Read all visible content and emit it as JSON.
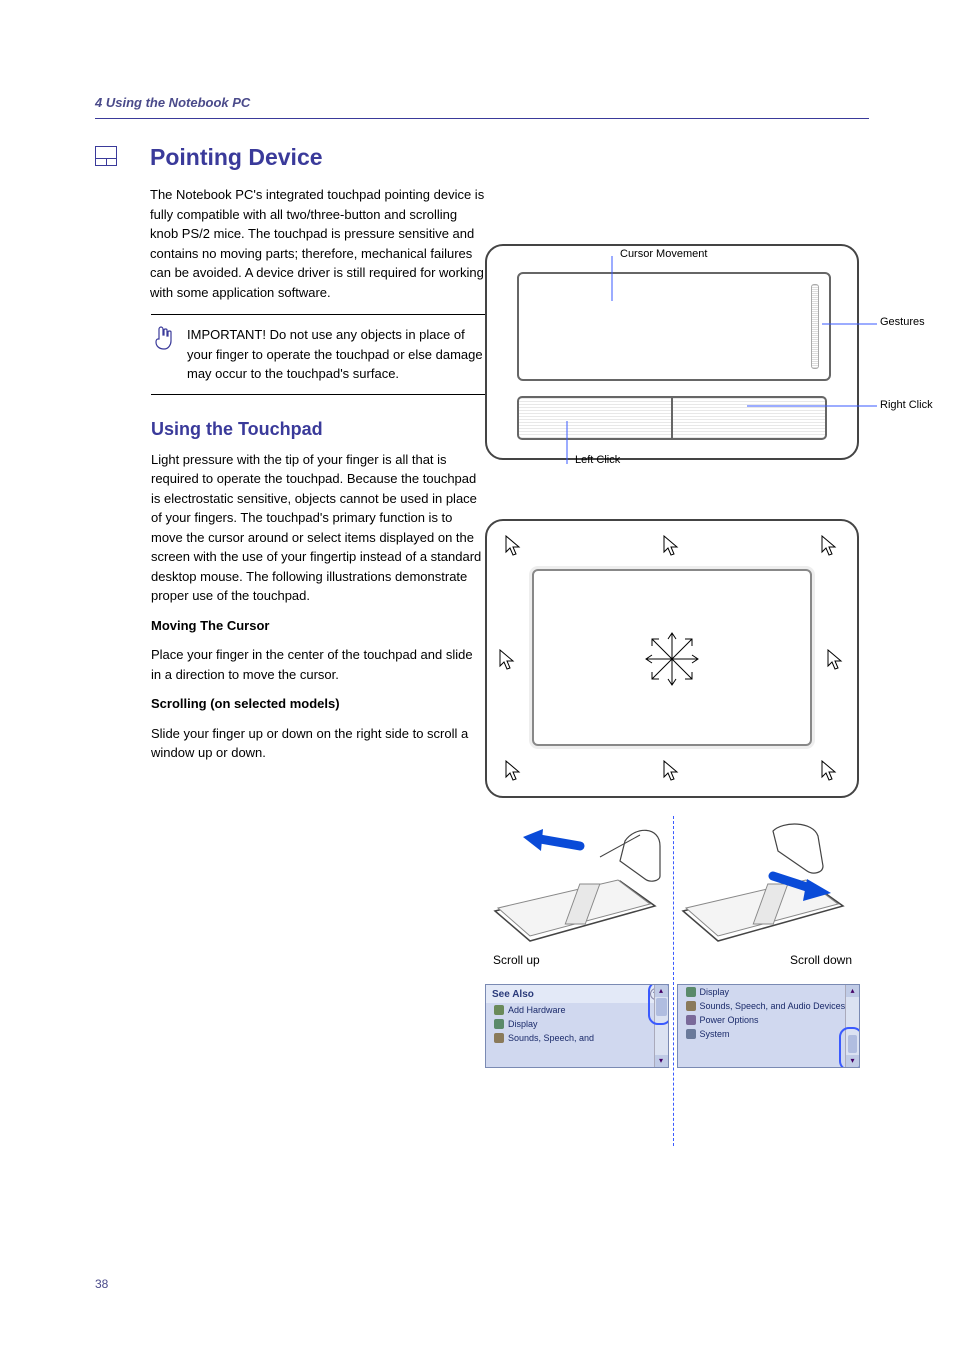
{
  "header": {
    "section": "4    Using the Notebook PC",
    "section_short": "4"
  },
  "title": "Pointing Device",
  "intro": "The Notebook PC's integrated touchpad pointing device is fully compatible with all two/three-button and scrolling knob PS/2 mice. The touchpad is pressure sensitive and contains no moving parts; therefore, mechanical failures can be avoided. A device driver is still required for working with some application software.",
  "important": "IMPORTANT! Do not use any objects in place of your finger to operate the touchpad or else damage may occur to the touchpad's surface.",
  "using_heading": "Using the Touchpad",
  "using_p1": "Light pressure with the tip of your finger is all that is required to operate the touchpad. Because the touchpad is electrostatic sensitive, objects cannot be used in place of your fingers. The touchpad's primary function is to move the cursor around or select items displayed on the screen with the use of your fingertip instead of a standard desktop mouse. The following illustrations demonstrate proper use of the touchpad.",
  "moving_heading": "Moving The Cursor",
  "moving_p": "Place your finger in the center of the touchpad and slide in a direction to move the cursor.",
  "scrolling_heading": "Scrolling (on selected models)",
  "scrolling_p": "Slide your finger up or down on the right side to scroll a window up or down.",
  "figure1": {
    "cursor_movement": "Cursor Movement",
    "gestures": "Gestures",
    "right_click": "Right Click",
    "left_click": "Left Click"
  },
  "figure3": {
    "scroll_up": "Scroll up",
    "scroll_down": "Scroll down"
  },
  "figure4": {
    "panel_left": {
      "header": "See Also",
      "items": [
        "Add Hardware",
        "Display",
        "Sounds, Speech, and"
      ]
    },
    "panel_right": {
      "items": [
        "Display",
        "Sounds, Speech, and Audio Devices",
        "Power Options",
        "System"
      ]
    }
  },
  "footer": {
    "page": "38"
  }
}
